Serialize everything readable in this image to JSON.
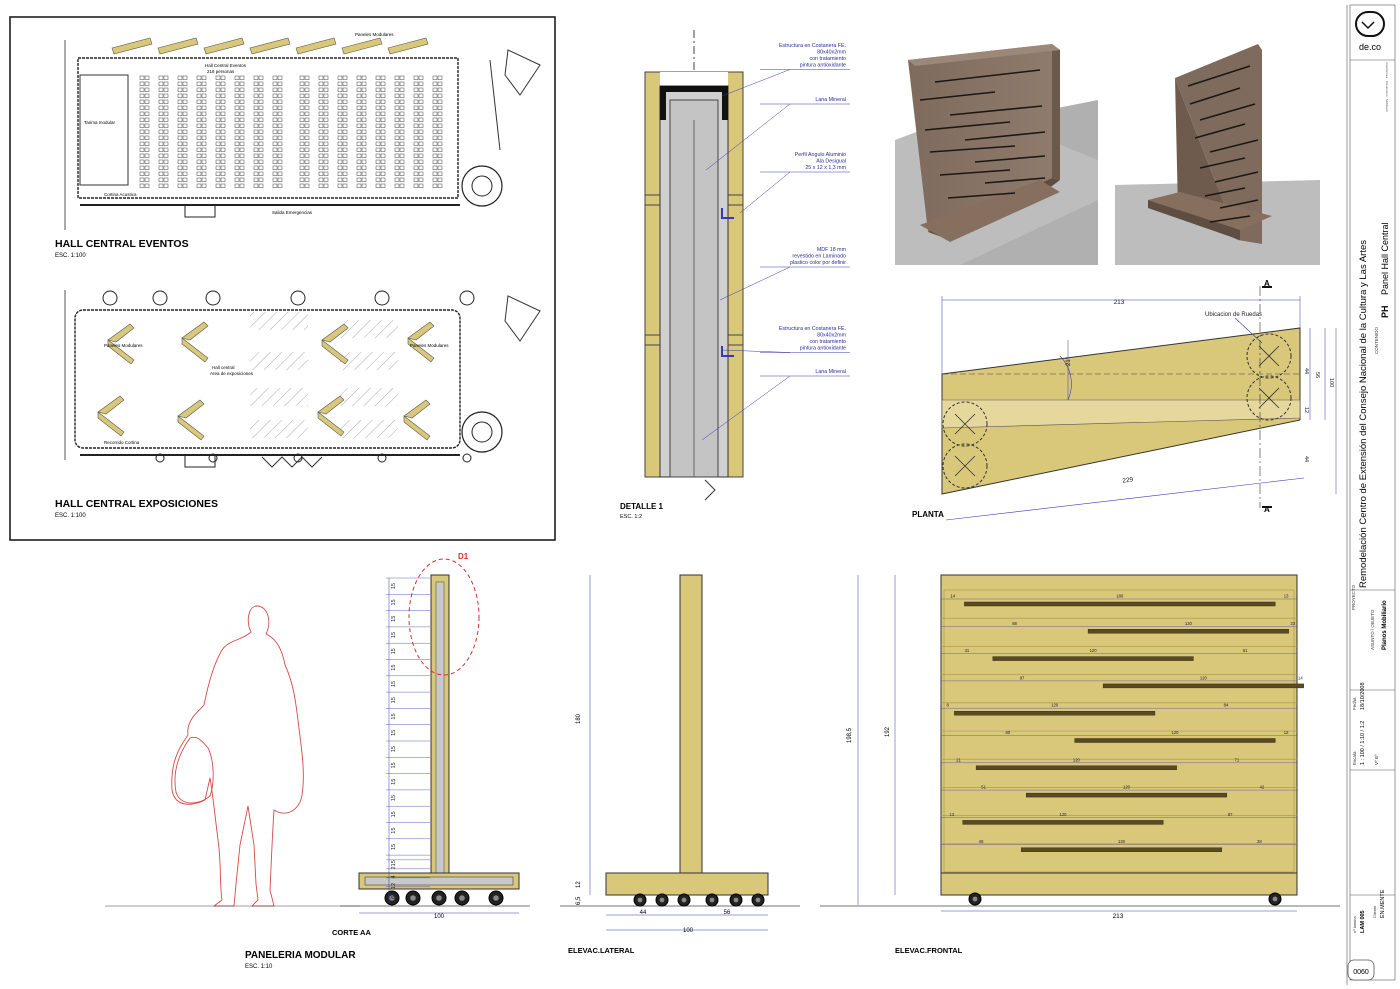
{
  "plans": {
    "eventos": {
      "title": "HALL CENTRAL EVENTOS",
      "scale": "ESC. 1:100",
      "labels": {
        "paneles": "Paneles Modulares",
        "hall_line1": "Hall Central Eventos",
        "hall_line2": "216 personas",
        "tarima": "Tarima modular",
        "cortina": "Cortina Acustica",
        "salida": "Salida Emergencias"
      }
    },
    "exposiciones": {
      "title": "HALL CENTRAL EXPOSICIONES",
      "scale": "ESC. 1:100",
      "labels": {
        "paneles_left": "Paneles Modulares",
        "paneles_right": "Paneles Modulares",
        "hall_line1": "Hall central",
        "hall_line2": "Area de exposiciones",
        "recorrido": "Recorrido Cortina"
      }
    }
  },
  "detalle": {
    "title": "DETALLE 1",
    "scale": "ESC. 1:2",
    "notes": [
      [
        "Estructura en Costanera FE.",
        "80x40x2mm",
        "con tratamiento",
        "pintura antioxidante"
      ],
      [
        "Lana Mineral"
      ],
      [
        "Perfil Angulo Aluminio",
        "Ala Desigual",
        "25 x 12 x 1,3  mm"
      ],
      [
        "MDF 18 mm",
        "revestido en  Laminado",
        "plastico color por definir"
      ],
      [
        "Estructura en Costanera FE.",
        "80x40x2mm",
        "con tratamiento",
        "pintura antioxidante"
      ],
      [
        "Lana Mineral"
      ]
    ]
  },
  "planta": {
    "title": "PLANTA",
    "section_mark": "A",
    "ruedas": "Ubicacion de Ruedas",
    "dims": {
      "top": "213",
      "bottom": "229",
      "angle": "21°",
      "r1": "44",
      "r2": "56",
      "r3": "100",
      "r4": "12",
      "r5": "44"
    }
  },
  "paneleria": {
    "title": "PANELERIA MODULAR",
    "scale": "ESC. 1:10",
    "corte": {
      "title": "CORTE AA",
      "detail_mark": "D1",
      "ticks": [
        "15",
        "15",
        "15",
        "15",
        "15",
        "15",
        "15",
        "15",
        "15",
        "15",
        "15",
        "15",
        "15",
        "15",
        "15",
        "15",
        "15",
        "15",
        "2",
        "4",
        "12",
        "6,5"
      ],
      "width": "100"
    },
    "lateral": {
      "title": "ELEVAC.LATERAL",
      "height": "180",
      "base": "12",
      "wheel": "6,5",
      "left": "44",
      "right": "56",
      "total": "100"
    },
    "frontal": {
      "title": "ELEVAC.FRONTAL",
      "h1": "198,5",
      "h2": "192",
      "width": "213",
      "slots": [
        {
          "l": "14",
          "w": "186",
          "r": "13"
        },
        {
          "l": "88",
          "w": "120",
          "r": "23"
        },
        {
          "l": "31",
          "w": "120",
          "r": "61"
        },
        {
          "l": "97",
          "w": "120",
          "r": "14"
        },
        {
          "l": "8",
          "w": "120",
          "r": "84"
        },
        {
          "l": "80",
          "w": "120",
          "r": "12"
        },
        {
          "l": "21",
          "w": "120",
          "r": "71"
        },
        {
          "l": "51",
          "w": "120",
          "r": "42"
        },
        {
          "l": "13",
          "w": "120",
          "r": "87"
        },
        {
          "l": "48",
          "w": "120",
          "r": "28"
        }
      ]
    }
  },
  "titleblock": {
    "logo": "de.co",
    "logo_sub": "Arquitectura · Interiorismo · Mobiliario",
    "proyecto_label": "PROYECTO",
    "proyecto": "Remodelación Centro de Extensión del Consejo Nacional de la Cultura y Las Artes",
    "contenido_label": "CONTENIDO",
    "code": "PH",
    "contenido": "Panel Hall Central",
    "asunto_label": "ASUNTO / OBJETO",
    "asunto": "Planos Mobiliario",
    "escala_label": "Escala",
    "escala": "1 : 100 / 1:10 / 1:2",
    "fecha_label": "Fecha",
    "fecha": "18/10/2008",
    "vb_label": "Vº Bº",
    "lamina_label": "nº lamina",
    "lamina": "LAM 005",
    "cliente_label": "Cliente",
    "cliente": "EN.MENTE",
    "number": "0060"
  },
  "colors": {
    "panel": "#d9c77a",
    "panel_dark": "#b9a653",
    "dim": "#3a3ab0",
    "red": "#d43030"
  }
}
